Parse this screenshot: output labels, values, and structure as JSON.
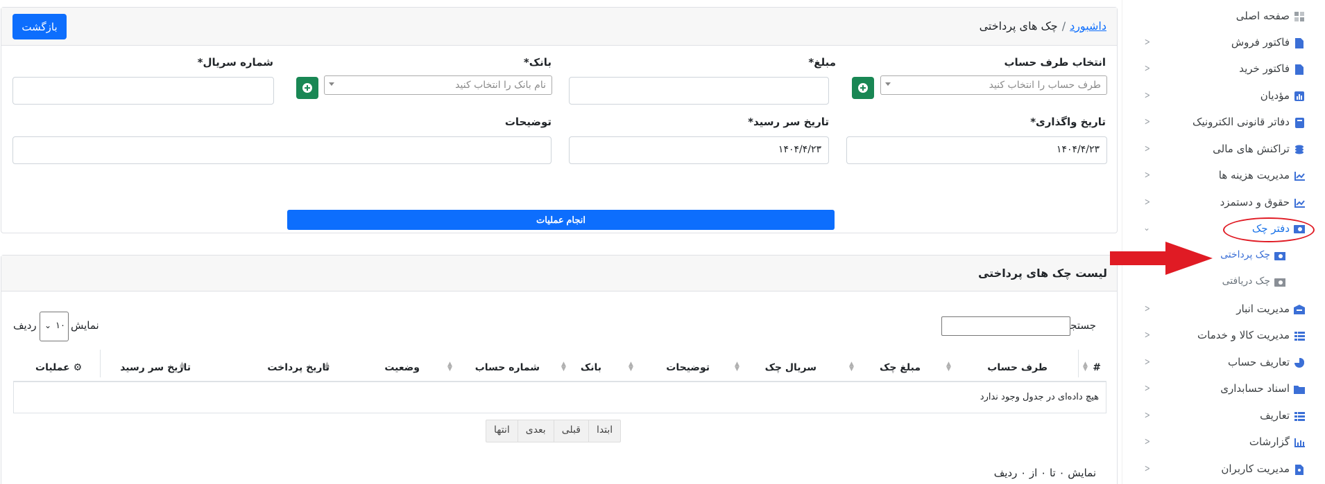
{
  "header": {
    "back_label": "بازگشت",
    "breadcrumb_link": "داشبورد",
    "breadcrumb_sep": "/",
    "breadcrumb_current": "چک های پرداختی"
  },
  "form": {
    "account_label": "انتخاب طرف حساب",
    "account_placeholder": "طرف حساب را انتخاب کنید",
    "amount_label": "مبلغ*",
    "bank_label": "بانک*",
    "bank_placeholder": "نام بانک را انتخاب کنید",
    "serial_label": "شماره سریال*",
    "assign_date_label": "تاریخ واگذاری*",
    "assign_date_value": "۱۴۰۴/۴/۲۳",
    "due_date_label": "تاریخ سر رسید*",
    "due_date_value": "۱۴۰۴/۴/۲۳",
    "desc_label": "توضیحات",
    "submit_label": "انجام عملیات"
  },
  "list": {
    "title": "لیست چک های پرداختی",
    "search_label": "جستجو:",
    "show_label": "نمایش",
    "rows_label": "ردیف",
    "page_length": "۱۰",
    "columns": [
      "#",
      "طرف حساب",
      "مبلغ چک",
      "سریال چک",
      "توضیحات",
      "بانک",
      "شماره حساب",
      "وضعیت",
      "تاریخ پرداخت",
      "تاریخ سر رسید",
      "عملیات"
    ],
    "empty_text": "هیچ داده‌ای در جدول وجود ندارد",
    "pager": [
      "ابتدا",
      "قبلی",
      "بعدی",
      "انتها"
    ],
    "info_text": "نمایش ۰ تا ۰ از ۰ ردیف"
  },
  "sidebar": {
    "items": [
      {
        "label": "صفحه اصلی",
        "icon": "dashboard-icon"
      },
      {
        "label": "فاکتور فروش",
        "icon": "file-icon"
      },
      {
        "label": "فاکتور خرید",
        "icon": "file-icon"
      },
      {
        "label": "مؤدیان",
        "icon": "chart-icon"
      },
      {
        "label": "دفاتر قانونی الکترونیک",
        "icon": "book-icon"
      },
      {
        "label": "تراکنش های مالی",
        "icon": "coins-icon"
      },
      {
        "label": "مدیریت هزینه ها",
        "icon": "line-chart-icon"
      },
      {
        "label": "حقوق و دستمزد",
        "icon": "line-chart-icon"
      },
      {
        "label": "دفتر چک",
        "icon": "money-icon"
      },
      {
        "label": "چک پرداختی",
        "icon": "money-icon"
      },
      {
        "label": "چک دریافتی",
        "icon": "money-icon"
      },
      {
        "label": "مدیریت انبار",
        "icon": "warehouse-icon"
      },
      {
        "label": "مدیریت کالا و خدمات",
        "icon": "list-icon"
      },
      {
        "label": "تعاریف حساب",
        "icon": "pie-icon"
      },
      {
        "label": "اسناد حسابداری",
        "icon": "folder-icon"
      },
      {
        "label": "تعاریف",
        "icon": "list-icon"
      },
      {
        "label": "گزارشات",
        "icon": "bar-chart-icon"
      },
      {
        "label": "مدیریت کاربران",
        "icon": "user-file-icon"
      }
    ]
  },
  "colors": {
    "primary": "#0d6efd",
    "success": "#198754",
    "annotation": "#e01b24"
  }
}
